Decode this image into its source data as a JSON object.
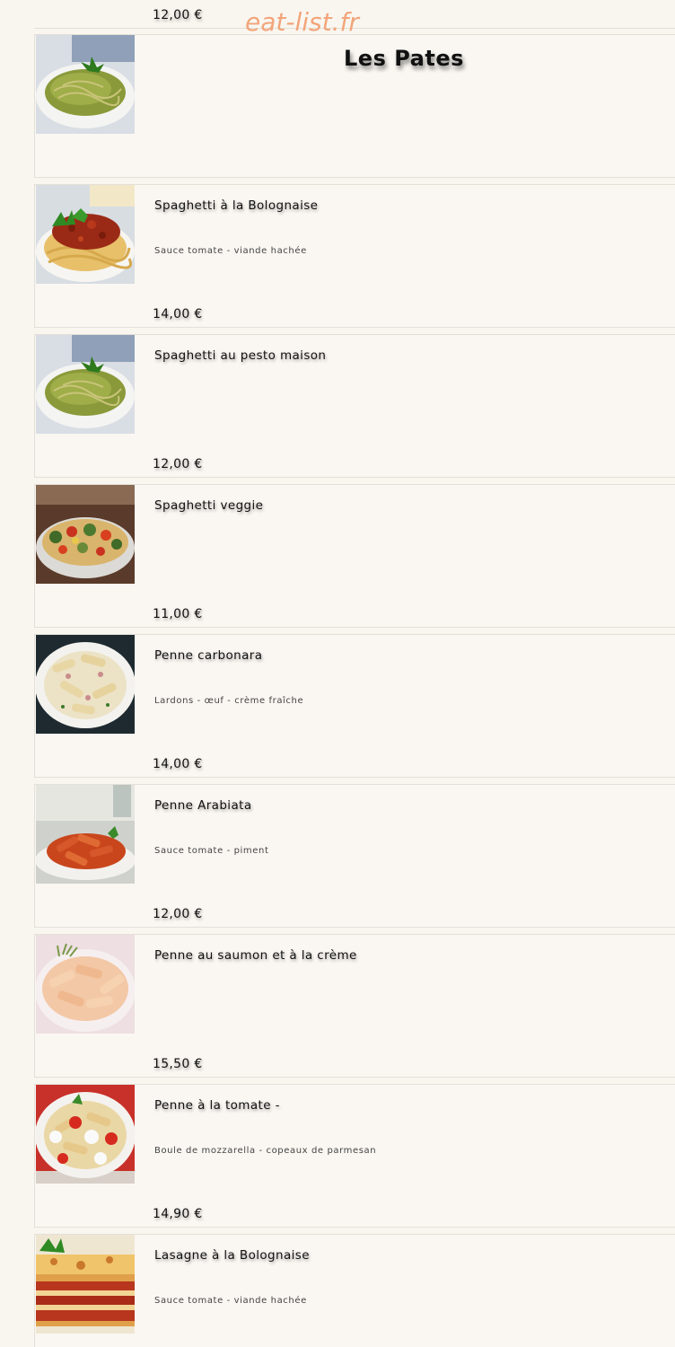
{
  "watermark": "eat-list.fr",
  "previous_item": {
    "price": "12,00 €"
  },
  "section": {
    "title": "Les Pates",
    "image_icon": "pesto-spaghetti-photo"
  },
  "items": [
    {
      "name": "Spaghetti à la Bolognaise",
      "description": "Sauce tomate - viande hachée",
      "price": "14,00 €",
      "image_icon": "bolognese-photo"
    },
    {
      "name": "Spaghetti au pesto maison",
      "description": "",
      "price": "12,00 €",
      "image_icon": "pesto-spaghetti-photo"
    },
    {
      "name": "Spaghetti veggie",
      "description": "",
      "price": "11,00 €",
      "image_icon": "veggie-spaghetti-photo"
    },
    {
      "name": "Penne carbonara",
      "description": "Lardons - œuf - crème fraîche",
      "price": "14,00 €",
      "image_icon": "carbonara-photo"
    },
    {
      "name": "Penne Arabiata",
      "description": "Sauce tomate - piment",
      "price": "12,00 €",
      "image_icon": "arrabiata-photo"
    },
    {
      "name": "Penne au saumon et à la crème",
      "description": "",
      "price": "15,50 €",
      "image_icon": "salmon-penne-photo"
    },
    {
      "name": "Penne à la tomate -",
      "description": "Boule de mozzarella - copeaux de parmesan",
      "price": "14,90 €",
      "image_icon": "tomato-mozzarella-penne-photo"
    },
    {
      "name": "Lasagne à la Bolognaise",
      "description": "Sauce tomate - viande hachée",
      "price": "",
      "image_icon": "lasagna-photo"
    }
  ],
  "colors": {
    "background": "#f9f6f0",
    "watermark": "#f2a57a",
    "border": "#e4e0d8",
    "text": "#111111"
  }
}
